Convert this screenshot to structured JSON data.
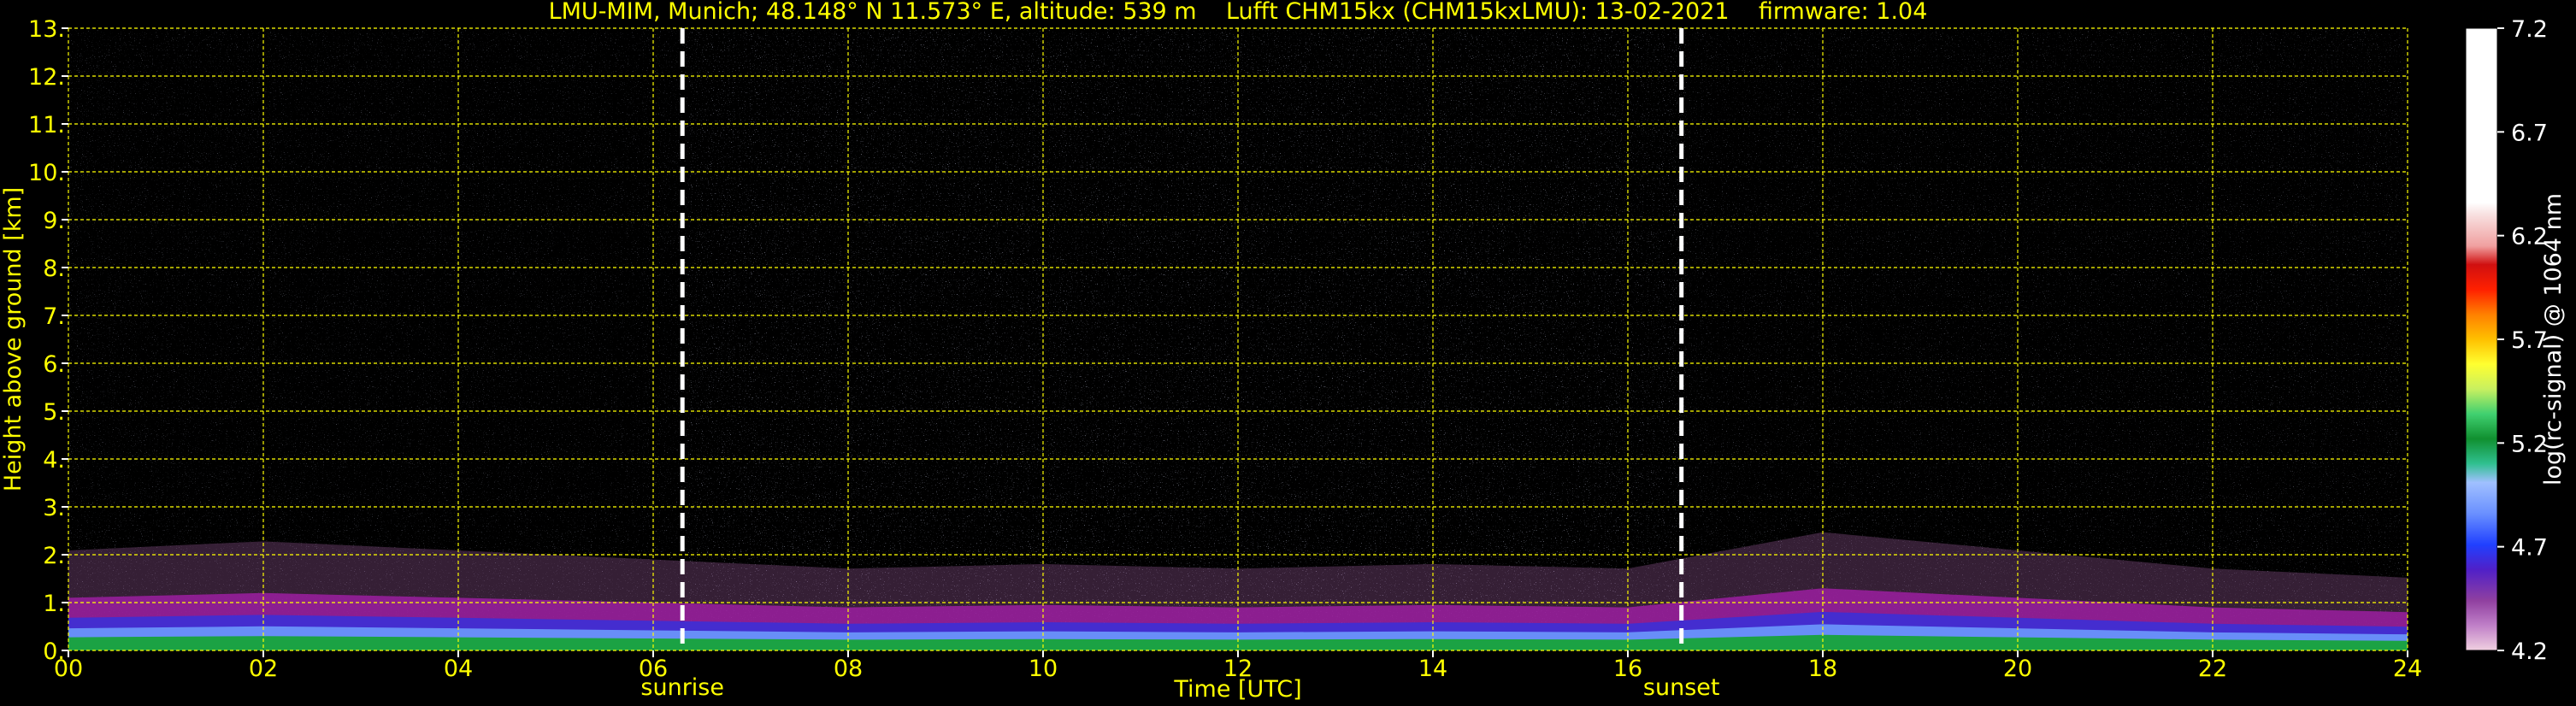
{
  "chart_data": {
    "type": "heatmap",
    "title": "LMU-MIM, Munich; 48.148° N 11.573° E, altitude: 539 m    Lufft CHM15kx (CHM15kxLMU): 13-02-2021    firmware: 1.04",
    "xlabel": "Time [UTC]",
    "ylabel": "Height above ground [km]",
    "xlim": [
      0,
      24
    ],
    "ylim": [
      0,
      13
    ],
    "x_ticks": [
      "00",
      "02",
      "04",
      "06",
      "08",
      "10",
      "12",
      "14",
      "16",
      "18",
      "20",
      "22",
      "24"
    ],
    "y_ticks": [
      "0.",
      "1.",
      "2.",
      "3.",
      "4.",
      "5.",
      "6.",
      "7.",
      "8.",
      "9.",
      "10.",
      "11.",
      "12.",
      "13."
    ],
    "grid": true,
    "annotations": [
      {
        "label": "sunrise",
        "x": 6.3
      },
      {
        "label": "sunset",
        "x": 16.55
      }
    ],
    "colorbar": {
      "label": "log(rc-signal) @ 1064 nm",
      "range": [
        4.2,
        7.2
      ],
      "ticks": [
        "4.2",
        "4.7",
        "5.2",
        "5.7",
        "6.2",
        "6.7",
        "7.2"
      ]
    },
    "boundary_layer": {
      "time": [
        0,
        2,
        4,
        6,
        8,
        10,
        12,
        14,
        16,
        18,
        20,
        22,
        24
      ],
      "top_km": [
        1.1,
        1.2,
        1.1,
        1.0,
        0.9,
        0.95,
        0.9,
        0.95,
        0.9,
        1.3,
        1.1,
        0.9,
        0.8
      ]
    },
    "colors": {
      "background": "#000000",
      "text": "#ffff00",
      "grid": "#ffff00",
      "marker": "#ffffff",
      "aerosol_top": "#9b1fa0",
      "aerosol_mid": "#3c2fd6",
      "near_ground": "#17a33a"
    }
  }
}
